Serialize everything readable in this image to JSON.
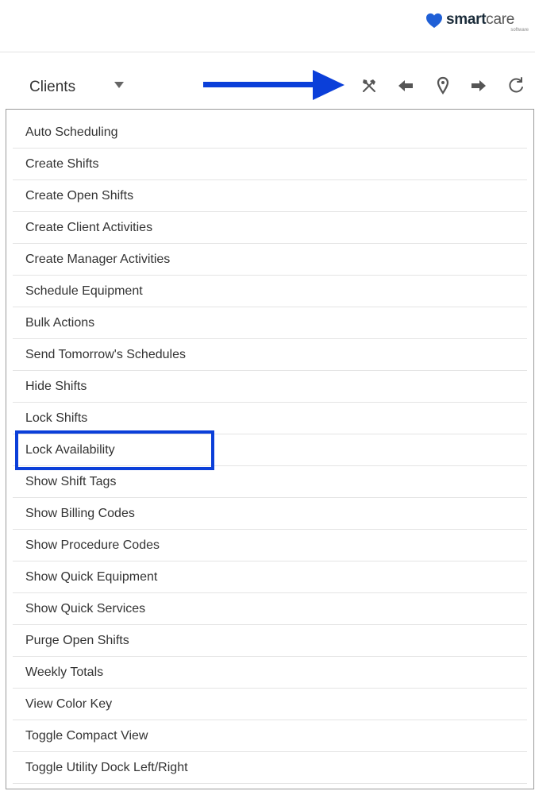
{
  "brand": {
    "logo_text_bold": "smart",
    "logo_text_light": "care",
    "logo_subtext": "software",
    "heart_color": "#1f5fd6"
  },
  "toolbar": {
    "dropdown_label": "Clients",
    "icons": [
      "tools-icon",
      "arrow-left-icon",
      "map-pin-icon",
      "arrow-right-icon",
      "refresh-icon"
    ]
  },
  "annotation": {
    "color": "#0b3fd9"
  },
  "menu": {
    "items": [
      {
        "label": "Auto Scheduling"
      },
      {
        "label": "Create Shifts"
      },
      {
        "label": "Create Open Shifts"
      },
      {
        "label": "Create Client Activities"
      },
      {
        "label": "Create Manager Activities"
      },
      {
        "label": "Schedule Equipment"
      },
      {
        "label": "Bulk Actions"
      },
      {
        "label": "Send Tomorrow's Schedules"
      },
      {
        "label": "Hide Shifts"
      },
      {
        "label": "Lock Shifts"
      },
      {
        "label": "Lock Availability"
      },
      {
        "label": "Show Shift Tags"
      },
      {
        "label": "Show Billing Codes"
      },
      {
        "label": "Show Procedure Codes"
      },
      {
        "label": "Show Quick Equipment"
      },
      {
        "label": "Show Quick Services"
      },
      {
        "label": "Purge Open Shifts"
      },
      {
        "label": "Weekly Totals"
      },
      {
        "label": "View Color Key"
      },
      {
        "label": "Toggle Compact View"
      },
      {
        "label": "Toggle Utility Dock Left/Right"
      }
    ]
  }
}
